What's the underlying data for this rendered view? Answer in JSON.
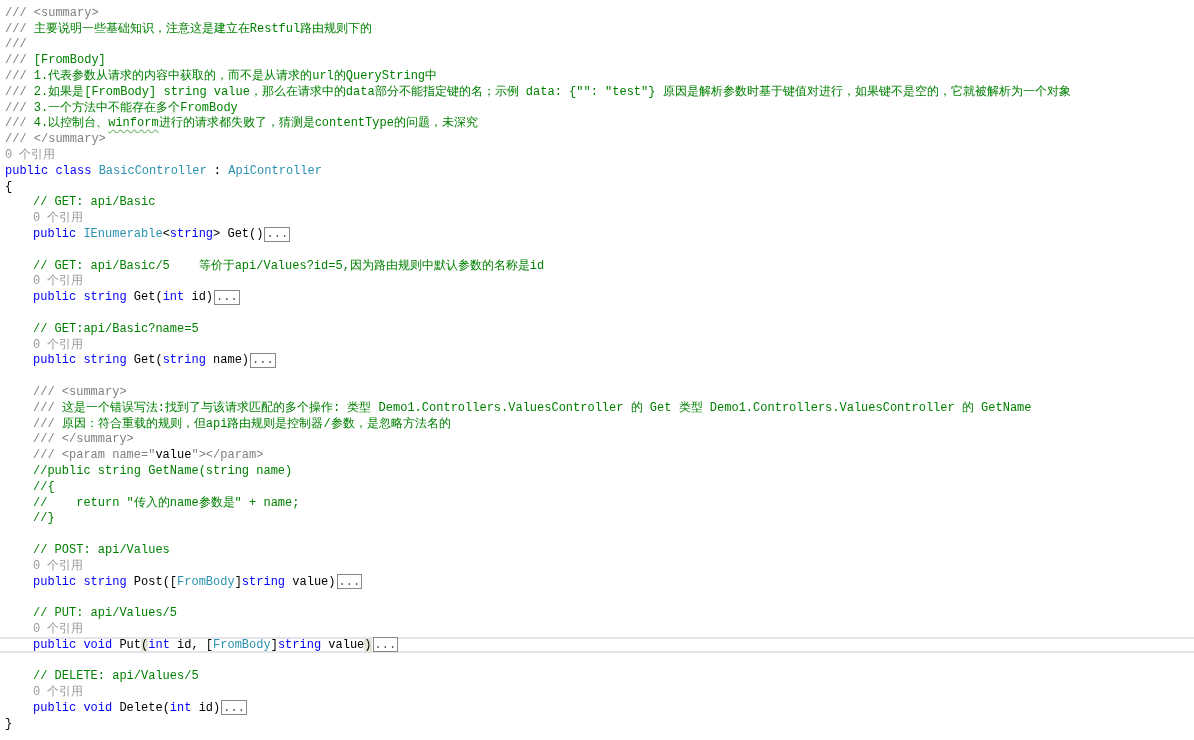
{
  "editor": {
    "lines": [
      {
        "kind": "code",
        "current": false,
        "tokens": [
          {
            "text": "/// <summary>",
            "kind": "doc"
          }
        ]
      },
      {
        "kind": "code",
        "current": false,
        "tokens": [
          {
            "text": "/// ",
            "kind": "doc"
          },
          {
            "text": "主要说明一些基础知识，注意这是建立在Restful路由规则下的",
            "kind": "comment"
          }
        ]
      },
      {
        "kind": "code",
        "current": false,
        "tokens": [
          {
            "text": "///",
            "kind": "doc"
          }
        ]
      },
      {
        "kind": "code",
        "current": false,
        "tokens": [
          {
            "text": "/// ",
            "kind": "doc"
          },
          {
            "text": "[FromBody]",
            "kind": "comment"
          }
        ]
      },
      {
        "kind": "code",
        "current": false,
        "tokens": [
          {
            "text": "/// ",
            "kind": "doc"
          },
          {
            "text": "1.代表参数从请求的内容中获取的，而不是从请求的url的QueryString中",
            "kind": "comment"
          }
        ]
      },
      {
        "kind": "code",
        "current": false,
        "tokens": [
          {
            "text": "/// ",
            "kind": "doc"
          },
          {
            "text": "2.如果是[FromBody] string value，那么在请求中的data部分不能指定键的名；示例 data: {\"\": \"test\"} 原因是解析参数时基于键值对进行，如果键不是空的，它就被解析为一个对象",
            "kind": "comment"
          }
        ]
      },
      {
        "kind": "code",
        "current": false,
        "tokens": [
          {
            "text": "/// ",
            "kind": "doc"
          },
          {
            "text": "3.一个方法中不能存在多个FromBody",
            "kind": "comment"
          }
        ]
      },
      {
        "kind": "code",
        "current": false,
        "tokens": [
          {
            "text": "/// ",
            "kind": "doc"
          },
          {
            "text": "4.以控制台、",
            "kind": "comment"
          },
          {
            "text": "winform",
            "kind": "squiggle"
          },
          {
            "text": "进行的请求都失败了，猜测是contentType的问题，未深究",
            "kind": "comment"
          }
        ]
      },
      {
        "kind": "code",
        "current": false,
        "tokens": [
          {
            "text": "/// </summary>",
            "kind": "doc"
          }
        ]
      },
      {
        "kind": "code",
        "current": false,
        "tokens": [
          {
            "text": "0 个引用",
            "kind": "codelens"
          }
        ]
      },
      {
        "kind": "code",
        "current": false,
        "tokens": [
          {
            "text": "public class ",
            "kind": "keyword"
          },
          {
            "text": "BasicController",
            "kind": "type"
          },
          {
            "text": " : ",
            "kind": "plain"
          },
          {
            "text": "ApiController",
            "kind": "type"
          }
        ]
      },
      {
        "kind": "code",
        "current": false,
        "tokens": [
          {
            "text": "{",
            "kind": "plain"
          }
        ],
        "children": [
          {
            "kind": "code",
            "current": false,
            "tokens": [
              {
                "text": "// GET: api/Basic",
                "kind": "comment"
              }
            ]
          },
          {
            "kind": "code",
            "current": false,
            "tokens": [
              {
                "text": "0 个引用",
                "kind": "codelens"
              }
            ]
          },
          {
            "kind": "code",
            "current": false,
            "tokens": [
              {
                "text": "public ",
                "kind": "keyword"
              },
              {
                "text": "IEnumerable",
                "kind": "type"
              },
              {
                "text": "<",
                "kind": "plain"
              },
              {
                "text": "string",
                "kind": "keyword"
              },
              {
                "text": "> Get()",
                "kind": "plain"
              },
              {
                "text": "...",
                "kind": "collapsed"
              }
            ]
          },
          {
            "kind": "blank",
            "current": false
          },
          {
            "kind": "code",
            "current": false,
            "tokens": [
              {
                "text": "// GET: api/Basic/5    等价于api/Values?id=5,因为路由规则中默认参数的名称是id",
                "kind": "comment"
              }
            ]
          },
          {
            "kind": "code",
            "current": false,
            "tokens": [
              {
                "text": "0 个引用",
                "kind": "codelens"
              }
            ]
          },
          {
            "kind": "code",
            "current": false,
            "tokens": [
              {
                "text": "public string ",
                "kind": "keyword"
              },
              {
                "text": "Get(",
                "kind": "plain"
              },
              {
                "text": "int",
                "kind": "keyword"
              },
              {
                "text": " id)",
                "kind": "plain"
              },
              {
                "text": "...",
                "kind": "collapsed"
              }
            ]
          },
          {
            "kind": "blank",
            "current": false
          },
          {
            "kind": "code",
            "current": false,
            "tokens": [
              {
                "text": "// GET:api/Basic?name=5",
                "kind": "comment"
              }
            ]
          },
          {
            "kind": "code",
            "current": false,
            "tokens": [
              {
                "text": "0 个引用",
                "kind": "codelens"
              }
            ]
          },
          {
            "kind": "code",
            "current": false,
            "tokens": [
              {
                "text": "public string ",
                "kind": "keyword"
              },
              {
                "text": "Get(",
                "kind": "plain"
              },
              {
                "text": "string",
                "kind": "keyword"
              },
              {
                "text": " name)",
                "kind": "plain"
              },
              {
                "text": "...",
                "kind": "collapsed"
              }
            ]
          },
          {
            "kind": "blank",
            "current": false
          },
          {
            "kind": "code",
            "current": false,
            "tokens": [
              {
                "text": "/// <summary>",
                "kind": "doc"
              }
            ]
          },
          {
            "kind": "code",
            "current": false,
            "tokens": [
              {
                "text": "/// ",
                "kind": "doc"
              },
              {
                "text": "这是一个错误写法:找到了与该请求匹配的多个操作: 类型 Demo1.Controllers.ValuesController 的 Get 类型 Demo1.Controllers.ValuesController 的 GetName",
                "kind": "comment"
              }
            ]
          },
          {
            "kind": "code",
            "current": false,
            "tokens": [
              {
                "text": "/// ",
                "kind": "doc"
              },
              {
                "text": "原因：符合重载的规则，但api路由规则是控制器/参数，是忽略方法名的",
                "kind": "comment"
              }
            ]
          },
          {
            "kind": "code",
            "current": false,
            "tokens": [
              {
                "text": "/// </summary>",
                "kind": "doc"
              }
            ]
          },
          {
            "kind": "code",
            "current": false,
            "tokens": [
              {
                "text": "/// <param name=\"",
                "kind": "doc"
              },
              {
                "text": "value",
                "kind": "plain"
              },
              {
                "text": "\"></param>",
                "kind": "doc"
              }
            ]
          },
          {
            "kind": "code",
            "current": false,
            "tokens": [
              {
                "text": "//public string GetName(string name)",
                "kind": "comment"
              }
            ]
          },
          {
            "kind": "code",
            "current": false,
            "tokens": [
              {
                "text": "//{",
                "kind": "comment"
              }
            ]
          },
          {
            "kind": "code",
            "current": false,
            "tokens": [
              {
                "text": "//    return \"传入的name参数是\" + name;",
                "kind": "comment"
              }
            ]
          },
          {
            "kind": "code",
            "current": false,
            "tokens": [
              {
                "text": "//}",
                "kind": "comment"
              }
            ]
          },
          {
            "kind": "blank",
            "current": false
          },
          {
            "kind": "code",
            "current": false,
            "tokens": [
              {
                "text": "// POST: api/Values",
                "kind": "comment"
              }
            ]
          },
          {
            "kind": "code",
            "current": false,
            "tokens": [
              {
                "text": "0 个引用",
                "kind": "codelens"
              }
            ]
          },
          {
            "kind": "code",
            "current": false,
            "tokens": [
              {
                "text": "public string ",
                "kind": "keyword"
              },
              {
                "text": "Post([",
                "kind": "plain"
              },
              {
                "text": "FromBody",
                "kind": "type"
              },
              {
                "text": "]",
                "kind": "plain"
              },
              {
                "text": "string",
                "kind": "keyword"
              },
              {
                "text": " value)",
                "kind": "plain"
              },
              {
                "text": "...",
                "kind": "collapsed"
              }
            ]
          },
          {
            "kind": "blank",
            "current": false
          },
          {
            "kind": "code",
            "current": false,
            "tokens": [
              {
                "text": "// PUT: api/Values/5",
                "kind": "comment"
              }
            ]
          },
          {
            "kind": "code",
            "current": false,
            "tokens": [
              {
                "text": "0 个引用",
                "kind": "codelens"
              }
            ]
          },
          {
            "kind": "code",
            "current": true,
            "tokens": [
              {
                "text": "public void ",
                "kind": "keyword"
              },
              {
                "text": "Put",
                "kind": "plain"
              },
              {
                "text": "(",
                "kind": "paren-match"
              },
              {
                "text": "int",
                "kind": "keyword"
              },
              {
                "text": " id, [",
                "kind": "plain"
              },
              {
                "text": "FromBody",
                "kind": "type"
              },
              {
                "text": "]",
                "kind": "plain"
              },
              {
                "text": "string",
                "kind": "keyword"
              },
              {
                "text": " value",
                "kind": "plain"
              },
              {
                "text": ")",
                "kind": "paren-match"
              },
              {
                "text": "...",
                "kind": "collapsed"
              }
            ]
          },
          {
            "kind": "blank",
            "current": false
          },
          {
            "kind": "code",
            "current": false,
            "tokens": [
              {
                "text": "// DELETE: api/Values/5",
                "kind": "comment"
              }
            ]
          },
          {
            "kind": "code",
            "current": false,
            "tokens": [
              {
                "text": "0 个引用",
                "kind": "codelens"
              }
            ]
          },
          {
            "kind": "code",
            "current": false,
            "tokens": [
              {
                "text": "public void ",
                "kind": "keyword"
              },
              {
                "text": "Delete(",
                "kind": "plain"
              },
              {
                "text": "int",
                "kind": "keyword"
              },
              {
                "text": " id)",
                "kind": "plain"
              },
              {
                "text": "...",
                "kind": "collapsed"
              }
            ]
          }
        ]
      },
      {
        "kind": "code",
        "current": false,
        "tokens": [
          {
            "text": "}",
            "kind": "plain"
          }
        ]
      }
    ]
  }
}
